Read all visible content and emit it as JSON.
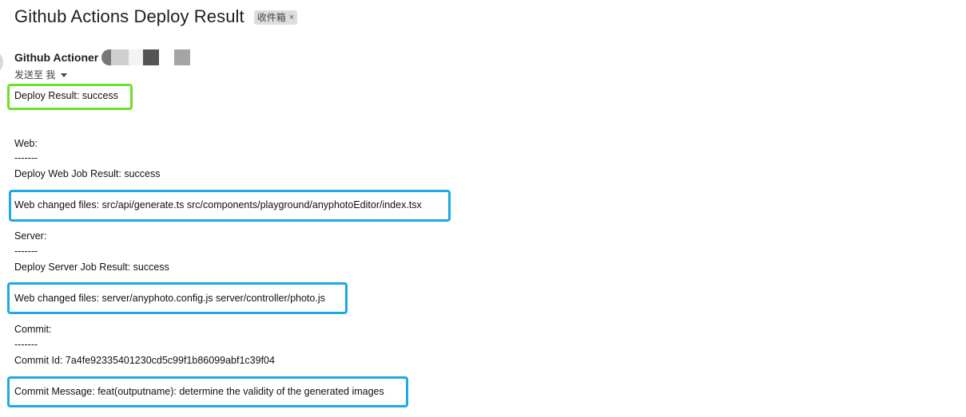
{
  "email": {
    "subject": "Github Actions Deploy Result",
    "label": "收件箱",
    "label_close": "×",
    "sender": "Github Actioner",
    "to": "发送至 我"
  },
  "body": {
    "deploy_result": "Deploy Result: success",
    "web_header": "Web:",
    "web_sep": "-------",
    "web_job_result": "Deploy Web Job Result: success",
    "web_changed_files": "Web changed files: src/api/generate.ts src/components/playground/anyphotoEditor/index.tsx",
    "server_header": "Server:",
    "server_sep": "-------",
    "server_job_result": "Deploy Server Job Result: success",
    "server_changed_files": "Web changed files: server/anyphoto.config.js server/controller/photo.js",
    "commit_header": "Commit:",
    "commit_sep": "-------",
    "commit_id": "Commit Id: 7a4fe92335401230cd5c99f1b86099abf1c39f04",
    "commit_message": "Commit Message: feat(outputname): determine the validity of the generated images"
  },
  "colors": {
    "highlight_green": "#6fe02a",
    "highlight_blue": "#1ea9e6"
  }
}
